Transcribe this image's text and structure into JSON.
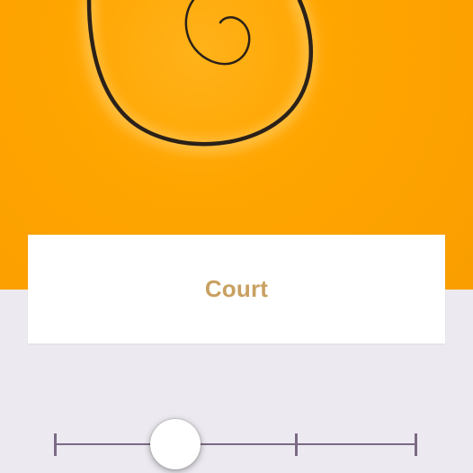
{
  "card": {
    "title": "Court"
  },
  "slider": {
    "steps": 4,
    "selected_index": 1,
    "value_fraction": 0.333
  },
  "colors": {
    "hero_background": "#FFA500",
    "card_title": "#C8A060",
    "track": "#7A6A85",
    "page_background": "#ECEAF0"
  },
  "icons": {
    "hero_illustration": "spiral-illustration"
  }
}
